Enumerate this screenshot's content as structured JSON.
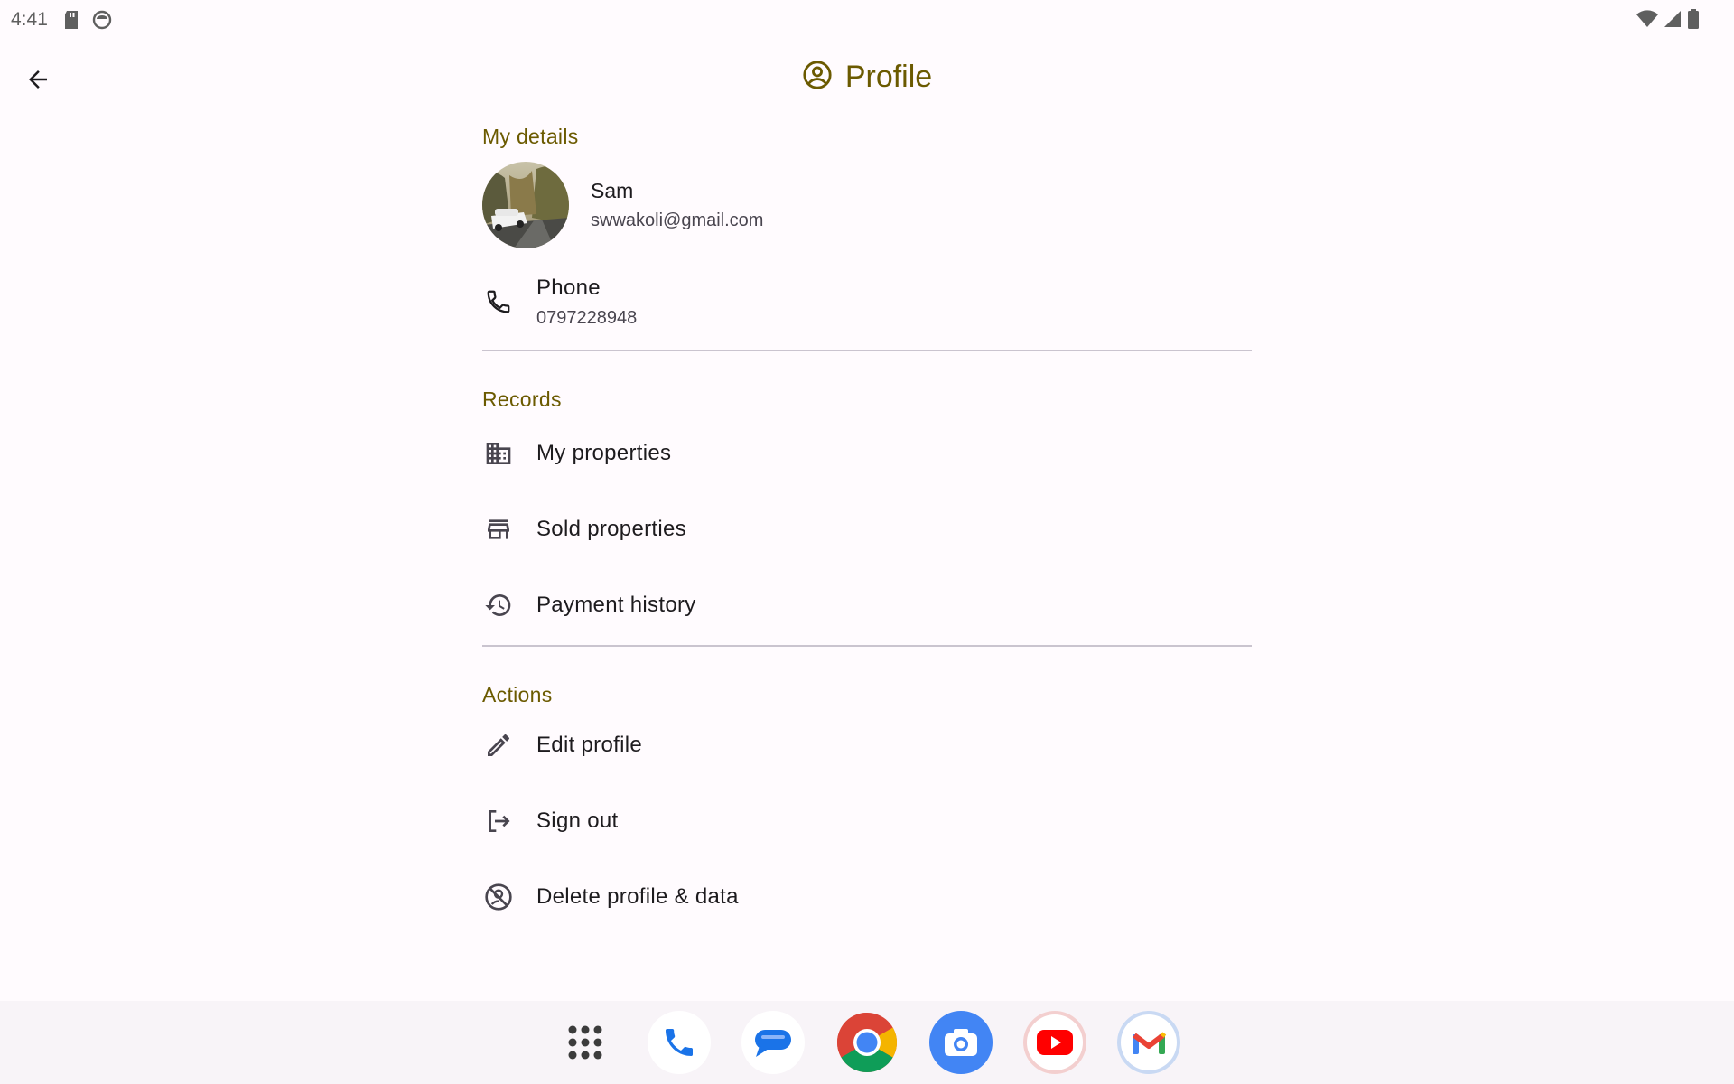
{
  "status_bar": {
    "time": "4:41",
    "left_icons": [
      "sd-card-icon",
      "app-notification-icon"
    ],
    "right_icons": [
      "wifi-icon",
      "cell-signal-icon",
      "battery-icon"
    ]
  },
  "header": {
    "title": "Profile",
    "title_icon": "account-circle-icon",
    "accent_color": "#6b5a00"
  },
  "my_details": {
    "section_title": "My details",
    "user": {
      "name": "Sam",
      "email": "swwakoli@gmail.com"
    },
    "phone": {
      "label": "Phone",
      "value": "0797228948",
      "icon": "phone-icon"
    }
  },
  "records": {
    "section_title": "Records",
    "items": [
      {
        "label": "My properties",
        "icon": "building-icon"
      },
      {
        "label": "Sold properties",
        "icon": "storefront-icon"
      },
      {
        "label": "Payment history",
        "icon": "history-icon"
      }
    ]
  },
  "actions": {
    "section_title": "Actions",
    "items": [
      {
        "label": "Edit profile",
        "icon": "pencil-icon"
      },
      {
        "label": "Sign out",
        "icon": "logout-icon"
      },
      {
        "label": "Delete profile & data",
        "icon": "block-user-icon"
      }
    ]
  },
  "dock": {
    "apps": [
      "app-drawer-icon",
      "phone-app-icon",
      "messages-app-icon",
      "chrome-app-icon",
      "camera-app-icon",
      "youtube-app-icon",
      "gmail-app-icon"
    ]
  }
}
